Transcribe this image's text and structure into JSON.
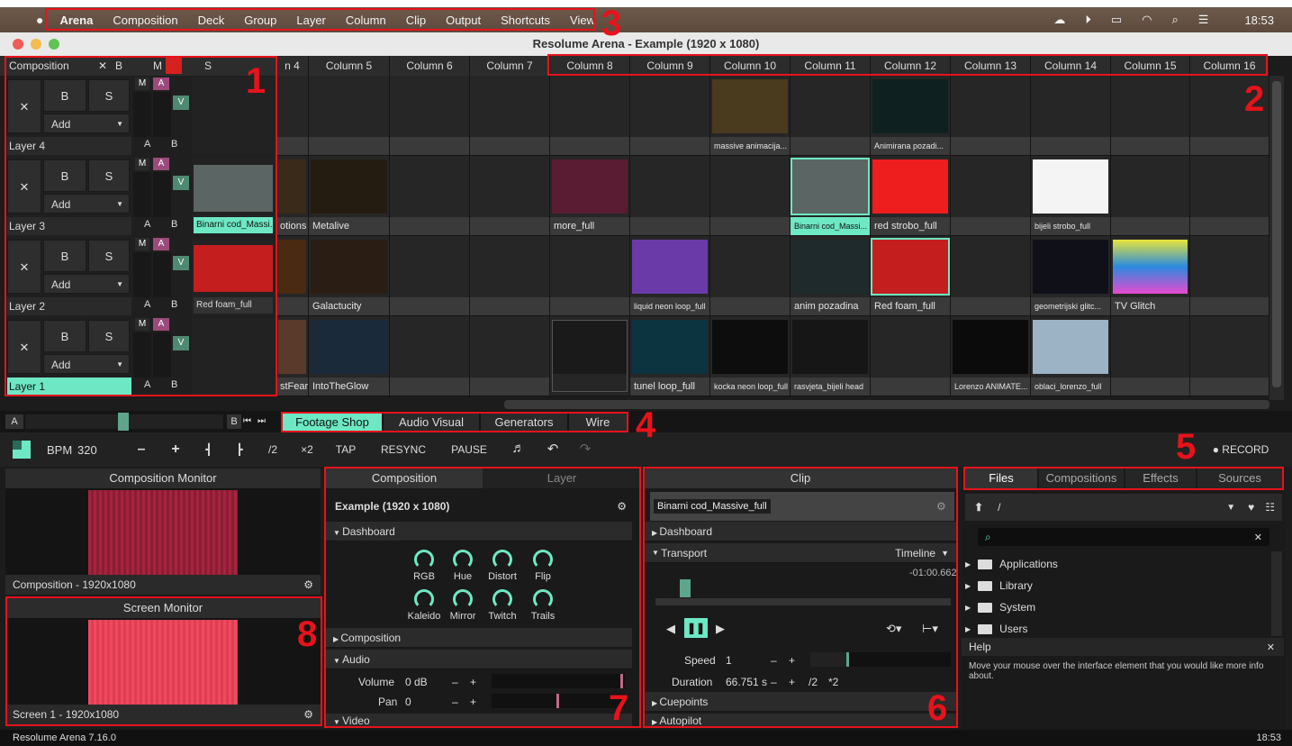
{
  "menubar": {
    "items": [
      "Arena",
      "Composition",
      "Deck",
      "Group",
      "Layer",
      "Column",
      "Clip",
      "Output",
      "Shortcuts",
      "View"
    ],
    "clock": "18:53"
  },
  "window": {
    "title": "Resolume Arena - Example (1920 x 1080)"
  },
  "callouts": [
    "1",
    "2",
    "3",
    "4",
    "5",
    "6",
    "7",
    "8"
  ],
  "composition_header": {
    "label": "Composition",
    "x": "✕",
    "b": "B",
    "m": "M",
    "s": "S"
  },
  "columns": [
    "n 4",
    "Column 5",
    "Column 6",
    "Column 7",
    "Column 8",
    "Column 9",
    "Column 10",
    "Column 11",
    "Column 12",
    "Column 13",
    "Column 14",
    "Column 15",
    "Column 16"
  ],
  "layers": [
    {
      "name": "Layer 4",
      "clips": [
        "",
        "",
        "",
        "",
        "",
        "",
        "massive animacija...",
        "",
        "Animirana pozadi...",
        "",
        "",
        "",
        ""
      ]
    },
    {
      "name": "Layer 3",
      "clip": "Binarni cod_Massi...",
      "clips": [
        "otions",
        "Metalive",
        "",
        "",
        "more_full",
        "",
        "",
        "Binarni cod_Massi...",
        "red strobo_full",
        "",
        "bijeli strobo_full",
        "",
        ""
      ]
    },
    {
      "name": "Layer 2",
      "clip": "Red foam_full",
      "clips": [
        "",
        "Galactucity",
        "",
        "",
        "",
        "liquid neon loop_full",
        "",
        "anim pozadina",
        "Red foam_full",
        "",
        "geometrijski glitc...",
        "TV Glitch",
        ""
      ]
    },
    {
      "name": "Layer 1",
      "clips": [
        "stFear",
        "IntoTheGlow",
        "",
        "",
        "",
        "tunel loop_full",
        "kocka neon loop_full",
        "rasvjeta_bijeli head",
        "",
        "Lorenzo ANIMATE...",
        "oblaci_lorenzo_full",
        "",
        ""
      ]
    }
  ],
  "layer_ctrl": {
    "x": "✕",
    "b": "B",
    "s": "S",
    "add": "Add",
    "m": "M",
    "a": "A",
    "v": "V",
    "ab_a": "A",
    "ab_b": "B"
  },
  "crossfader": {
    "a": "A",
    "b": "B",
    "k1": "⏮",
    "k2": "⏭"
  },
  "deck_tabs": [
    "Footage Shop",
    "Audio Visual",
    "Generators",
    "Wire"
  ],
  "transport": {
    "bpm_label": "BPM",
    "bpm_value": "320",
    "minus": "–",
    "plus": "+",
    "nudge_l": "┫",
    "nudge_r": "┣",
    "half": "/2",
    "double": "×2",
    "tap": "TAP",
    "resync": "RESYNC",
    "pause": "PAUSE",
    "record": "● RECORD"
  },
  "comp_monitor": {
    "title": "Composition Monitor",
    "footer": "Composition - 1920x1080"
  },
  "screen_monitor": {
    "title": "Screen Monitor",
    "footer": "Screen 1 - 1920x1080"
  },
  "comp_panel": {
    "tabs": [
      "Composition",
      "Layer"
    ],
    "name": "Example (1920 x 1080)",
    "dashboard": "Dashboard",
    "knobs": [
      "RGB",
      "Hue",
      "Distort",
      "Flip",
      "Kaleido",
      "Mirror",
      "Twitch",
      "Trails"
    ],
    "composition": "Composition",
    "audio": "Audio",
    "volume_label": "Volume",
    "volume_value": "0 dB",
    "pan_label": "Pan",
    "pan_value": "0",
    "video": "Video",
    "minus": "–",
    "plus": "+"
  },
  "clip_panel": {
    "title": "Clip",
    "name": "Binarni cod_Massive_full",
    "dashboard": "Dashboard",
    "transport": "Transport",
    "timeline": "Timeline",
    "time": "-01:00.662",
    "speed_label": "Speed",
    "speed_value": "1",
    "duration_label": "Duration",
    "duration_value": "66.751 s",
    "half": "/2",
    "double": "*2",
    "cuepoints": "Cuepoints",
    "autopilot": "Autopilot",
    "minus": "–",
    "plus": "+"
  },
  "browser": {
    "tabs": [
      "Files",
      "Compositions",
      "Effects",
      "Sources"
    ],
    "path": "/",
    "folders": [
      "Applications",
      "Library",
      "System",
      "Users"
    ],
    "help_title": "Help",
    "help_text": "Move your mouse over the interface element that you would like more info about."
  },
  "status": {
    "version": "Resolume Arena 7.16.0",
    "time": "18:53"
  }
}
